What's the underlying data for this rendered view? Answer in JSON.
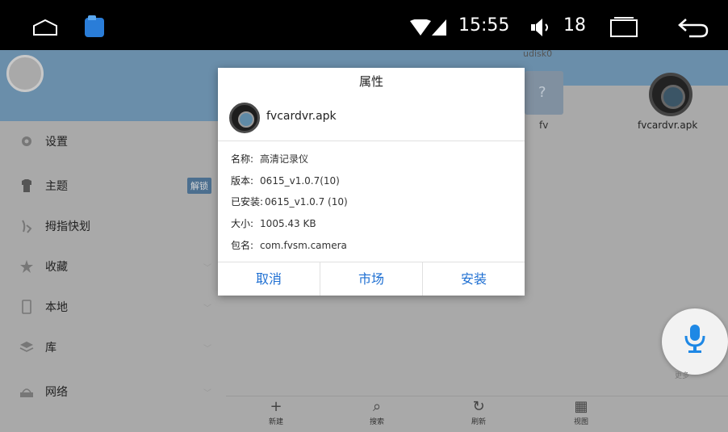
{
  "status_bar": {
    "time": "15:55",
    "volume": "18"
  },
  "sidebar": {
    "items": [
      {
        "label": "设置",
        "icon": "gear-icon"
      },
      {
        "label": "主题",
        "icon": "shirt-icon",
        "badge": "解锁"
      },
      {
        "label": "拇指快划",
        "icon": "thumb-gesture-icon"
      },
      {
        "label": "收藏",
        "icon": "star-icon"
      },
      {
        "label": "本地",
        "icon": "phone-icon"
      },
      {
        "label": "库",
        "icon": "layers-icon"
      },
      {
        "label": "网络",
        "icon": "network-icon"
      }
    ]
  },
  "path": {
    "text": "udisk0"
  },
  "files": [
    {
      "name": "fv",
      "icon": "unknown-file-icon"
    },
    {
      "name": "fvcardvr.apk",
      "icon": "camera-lens-icon"
    }
  ],
  "bottom_bar": [
    {
      "label": "新建",
      "icon": "plus-icon"
    },
    {
      "label": "搜索",
      "icon": "search-icon"
    },
    {
      "label": "刷新",
      "icon": "refresh-icon"
    },
    {
      "label": "视图",
      "icon": "grid-view-icon"
    }
  ],
  "fab": {
    "more_label": "更多"
  },
  "dialog": {
    "title": "属性",
    "filename": "fvcardvr.apk",
    "rows": [
      {
        "key": "名称:",
        "value": "高清记录仪"
      },
      {
        "key": "版本:",
        "value": "0615_v1.0.7(10)"
      },
      {
        "key": "已安装:",
        "value": "0615_v1.0.7 (10)"
      },
      {
        "key": "大小:",
        "value": "1005.43 KB"
      },
      {
        "key": "包名:",
        "value": "com.fvsm.camera"
      }
    ],
    "buttons": {
      "cancel": "取消",
      "market": "市场",
      "install": "安装"
    }
  },
  "colors": {
    "accent": "#1e6fd2",
    "header_blue": "#6a8eaa"
  }
}
